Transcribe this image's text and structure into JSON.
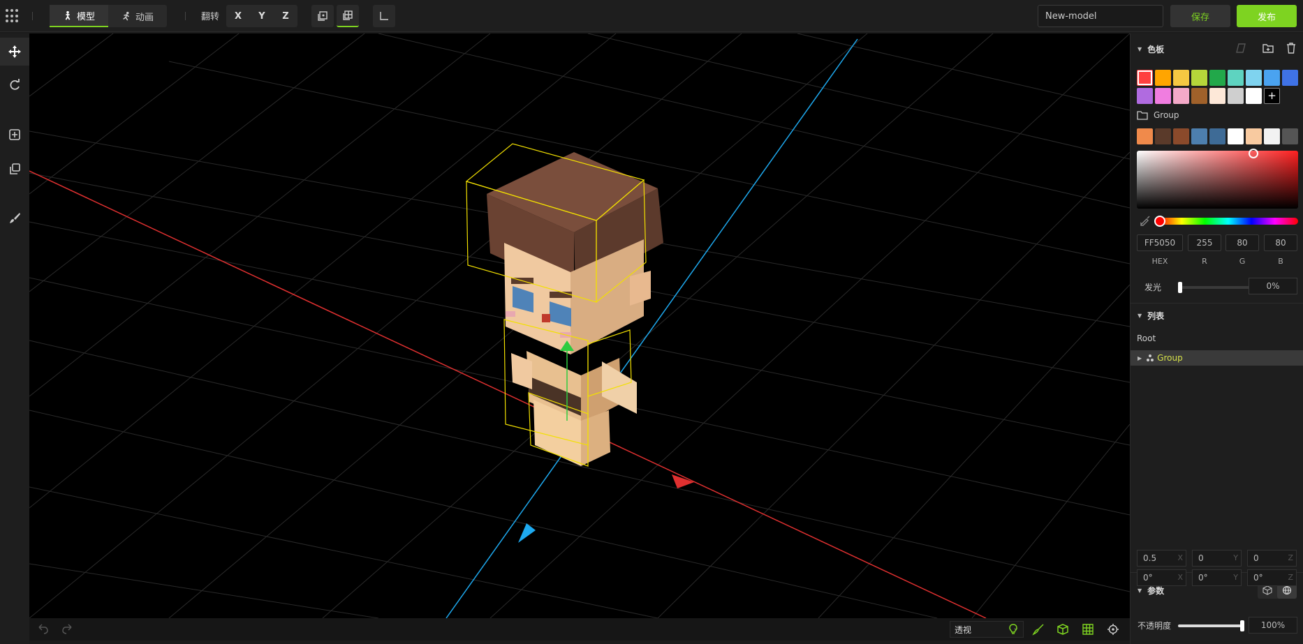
{
  "topbar": {
    "mode_model": "模型",
    "mode_animation": "动画",
    "flip_label": "翻转",
    "axes": [
      "X",
      "Y",
      "Z"
    ],
    "model_name": "New-model",
    "save_label": "保存",
    "publish_label": "发布"
  },
  "viewport": {
    "view_mode": "透视"
  },
  "palette": {
    "title": "色板",
    "colors_row1": [
      "#ff4040",
      "#ffa500",
      "#f5c842",
      "#b5d63a",
      "#22a84a",
      "#5ed3c0",
      "#7fd3ef",
      "#4aa3f0",
      "#3f72e6"
    ],
    "colors_row2": [
      "#b06be0",
      "#f07de0",
      "#f4a9c8",
      "#a0612a",
      "#fde8d8",
      "#cfcfcf",
      "#ffffff"
    ],
    "group_label": "Group",
    "group_colors": [
      "#f08a4b",
      "#5a3a2a",
      "#8b4a2b",
      "#4d7fae",
      "#3e6b96",
      "#ffffff",
      "#f8caa0",
      "#f2f2f2",
      "#555555"
    ]
  },
  "color": {
    "hex": "FF5050",
    "r": "255",
    "g": "80",
    "b": "80",
    "hex_label": "HEX",
    "r_label": "R",
    "g_label": "G",
    "b_label": "B",
    "glow_label": "发光",
    "glow_value": "0%"
  },
  "list": {
    "title": "列表",
    "root": "Root",
    "group": "Group"
  },
  "params": {
    "title": "参数",
    "pos": [
      {
        "value": "0.5",
        "axis": "X"
      },
      {
        "value": "0",
        "axis": "Y"
      },
      {
        "value": "0",
        "axis": "Z"
      }
    ],
    "rot": [
      {
        "value": "0°",
        "axis": "X"
      },
      {
        "value": "0°",
        "axis": "Y"
      },
      {
        "value": "0°",
        "axis": "Z"
      }
    ],
    "opacity_label": "不透明度",
    "opacity_value": "100%"
  }
}
